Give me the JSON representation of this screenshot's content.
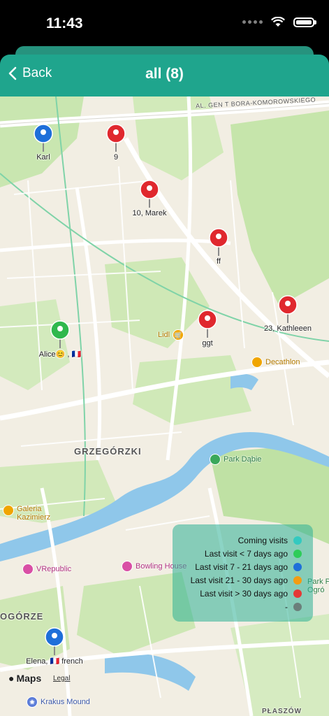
{
  "status_bar": {
    "time": "11:43"
  },
  "navbar": {
    "back_label": "Back",
    "title": "all (8)"
  },
  "map": {
    "street_label": "AL. GEN T BORA-KOMOROWSKIEGO",
    "areas": [
      "GRZEGÓRZKI",
      "OGÓRZE",
      "PŁASZÓW"
    ],
    "pois": {
      "lidl": "Lidl",
      "decathlon": "Decathlon",
      "park_dabie": "Park Dąbie",
      "galeria_line1": "Galeria",
      "galeria_line2": "Kazimierz",
      "vrepublic": "VRepublic",
      "bowling": "Bowling House",
      "park_right_line1": "Park P",
      "park_right_line2": "Ogró",
      "krakus": "Krakus Mound"
    },
    "pins": [
      {
        "label": "Karl",
        "color": "#1e6fd9"
      },
      {
        "label": "9",
        "color": "#e0282e"
      },
      {
        "label": "10, Marek",
        "color": "#e0282e"
      },
      {
        "label": "ff",
        "color": "#e0282e"
      },
      {
        "label": "23, Kathleeen",
        "color": "#e0282e"
      },
      {
        "label": "ggt",
        "color": "#e0282e"
      },
      {
        "label": "Alice😊 , 🇫🇷",
        "color": "#2fb84d"
      },
      {
        "label": "Elena, 🇫🇷 french",
        "color": "#1e6fd9"
      }
    ],
    "attribution": {
      "maps": "Maps",
      "legal": "Legal"
    }
  },
  "legend": {
    "items": [
      {
        "label": "Coming visits",
        "color": "#33c9c0"
      },
      {
        "label": "Last visit < 7 days ago",
        "color": "#2ecc59"
      },
      {
        "label": "Last visit 7 - 21 days ago",
        "color": "#1e6fd9"
      },
      {
        "label": "Last visit 21 - 30 days ago",
        "color": "#f39c12"
      },
      {
        "label": "Last visit > 30 days ago",
        "color": "#e53935"
      },
      {
        "label": "-",
        "color": "#6b7f7a"
      }
    ]
  }
}
